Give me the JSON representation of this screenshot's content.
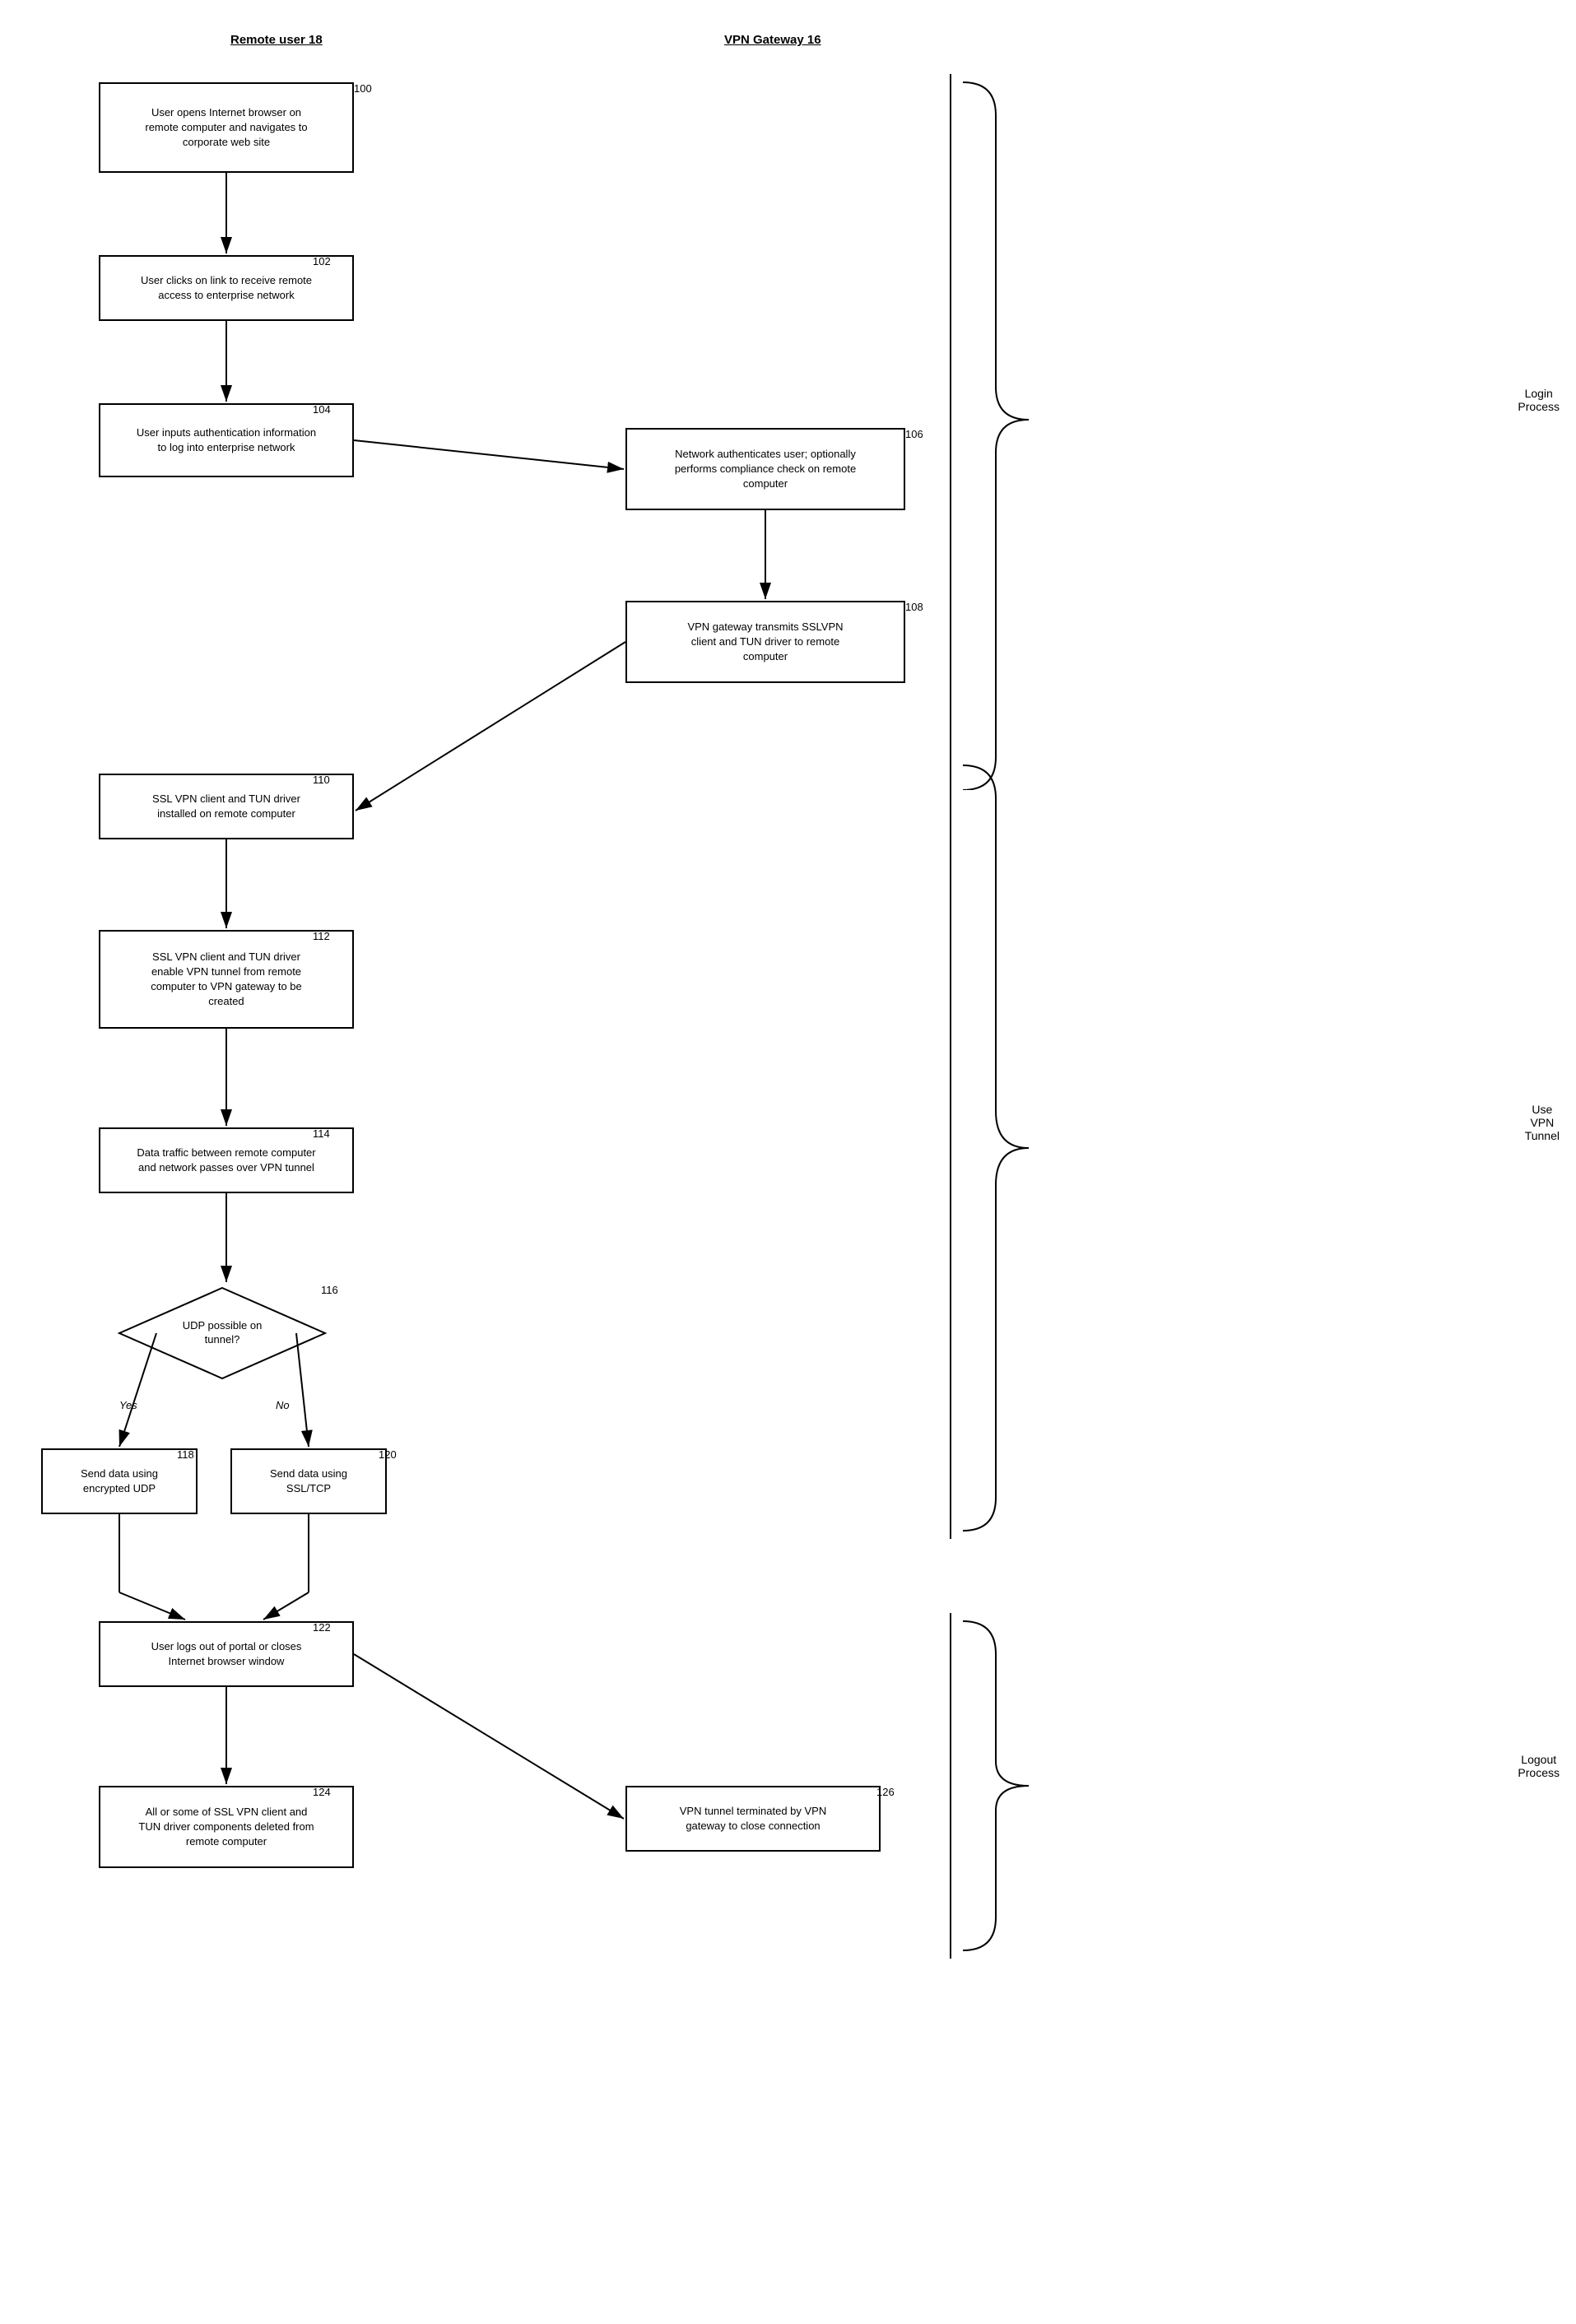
{
  "headers": {
    "remote_user": "Remote user 18",
    "vpn_gateway": "VPN Gateway 16"
  },
  "steps": {
    "s100": {
      "label": "100",
      "text": "User opens Internet browser on\nremote computer and navigates to\ncorporate web site"
    },
    "s102": {
      "label": "102",
      "text": "User clicks on link to receive remote\naccess to enterprise network"
    },
    "s104": {
      "label": "104",
      "text": "User inputs authentication information\nto log into enterprise network"
    },
    "s106": {
      "label": "106",
      "text": "Network authenticates user; optionally\nperforms compliance check on remote\ncomputer"
    },
    "s108": {
      "label": "108",
      "text": "VPN gateway transmits SSLVPN\nclient and TUN driver to remote\ncomputer"
    },
    "s110": {
      "label": "110",
      "text": "SSL VPN client and TUN driver\ninstalled on remote computer"
    },
    "s112": {
      "label": "112",
      "text": "SSL VPN client and TUN driver\nenable VPN tunnel from remote\ncomputer to VPN gateway to be\ncreated"
    },
    "s114": {
      "label": "114",
      "text": "Data traffic between remote computer\nand network passes over VPN tunnel"
    },
    "s116": {
      "label": "116",
      "text": "UDP possible on tunnel?"
    },
    "s118": {
      "label": "118",
      "text": "Send data using\nencrypted UDP"
    },
    "s120": {
      "label": "120",
      "text": "Send data using\nSSL/TCP"
    },
    "s122": {
      "label": "122",
      "text": "User logs out of portal or closes\nInternet browser window"
    },
    "s124": {
      "label": "124",
      "text": "All or some of SSL VPN client and\nTUN driver components deleted from\nremote computer"
    },
    "s126": {
      "label": "126",
      "text": "VPN tunnel terminated by VPN\ngateway to close connection"
    }
  },
  "brace_labels": {
    "login": "Login\nProcess",
    "use_vpn": "Use\nVPN\nTunnel",
    "logout": "Logout\nProcess"
  },
  "branch_labels": {
    "yes": "Yes",
    "no": "No"
  }
}
